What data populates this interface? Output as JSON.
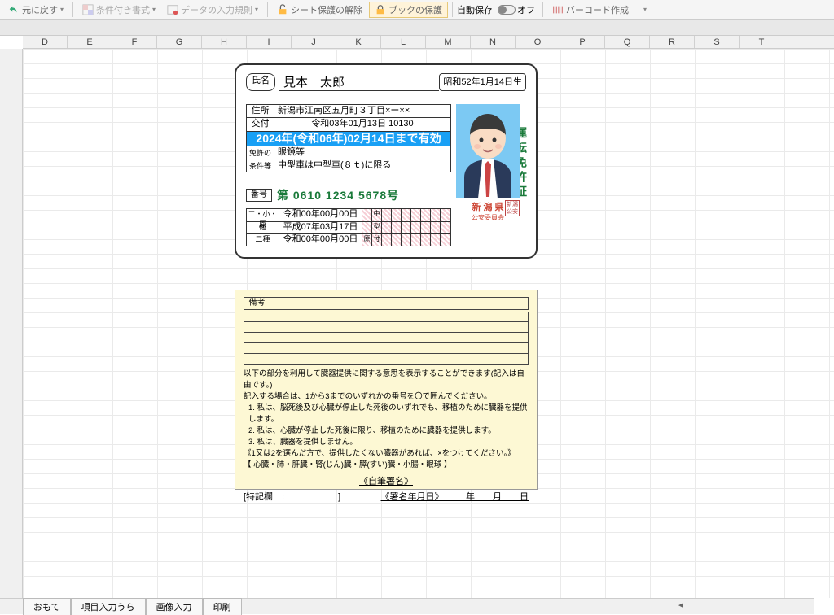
{
  "toolbar": {
    "undo": "元に戻す",
    "cond_fmt": "条件付き書式",
    "data_validation": "データの入力規則",
    "unprotect_sheet": "シート保護の解除",
    "protect_book": "ブックの保護",
    "autosave": "自動保存",
    "autosave_state": "オフ",
    "barcode": "バーコード作成"
  },
  "columns": [
    "D",
    "E",
    "F",
    "G",
    "H",
    "I",
    "J",
    "K",
    "L",
    "M",
    "N",
    "O",
    "P",
    "Q",
    "R",
    "S",
    "T"
  ],
  "license": {
    "name_label": "氏名",
    "name": "見本　太郎",
    "birth": "昭和52年1月14日生",
    "addr_label": "住所",
    "address": "新潟市江南区五月町３丁目×ー××",
    "issue_label": "交付",
    "issue": "令和03年01月13日  10130",
    "valid_until": "2024年(令和06年)02月14日まで有効",
    "cond_label1": "免許の",
    "cond_label2": "条件等",
    "cond1": "眼鏡等",
    "cond2": "中型車は中型車(８ｔ)に限る",
    "num_label": "番号",
    "number": "第 0610 1234  5678号",
    "date_label1": "二・小・原",
    "date_label2": "他",
    "date_label3": "二種",
    "date1": "令和00年00月00日",
    "date2": "平成07年03月17日",
    "date3": "令和00年00月00日",
    "title": "運転免許証",
    "pref": "新 潟 県",
    "comm": "公安委員会",
    "seal": "新潟公安",
    "grid_chars": [
      "中",
      "型",
      "",
      "",
      "原",
      "付"
    ]
  },
  "back": {
    "bikou_label": "備考",
    "line1": "以下の部分を利用して臓器提供に関する意思を表示することができます(記入は自由です。)",
    "line2": "記入する場合は、1から3までのいずれかの番号を〇で囲んでください。",
    "opt1": "1. 私は、脳死後及び心臓が停止した死後のいずれでも、移植のために臓器を提供します。",
    "opt2": "2. 私は、心臓が停止した死後に限り、移植のために臓器を提供します。",
    "opt3": "3. 私は、臓器を提供しません。",
    "line6": "《1又は2を選んだ方で、提供したくない臓器があれば、×をつけてください。》",
    "line7": "【 心臓・肺・肝臓・腎(じん)臓・膵(すい)臓・小腸・眼球 】",
    "sign_label": "《自筆署名》",
    "tokki": "[特記欄　:",
    "tokki_close": "]",
    "sign_date": "《署名年月日》　　　年　　月　　日"
  },
  "tabs": [
    "おもて",
    "項目入力うら",
    "画像入力",
    "印刷"
  ]
}
